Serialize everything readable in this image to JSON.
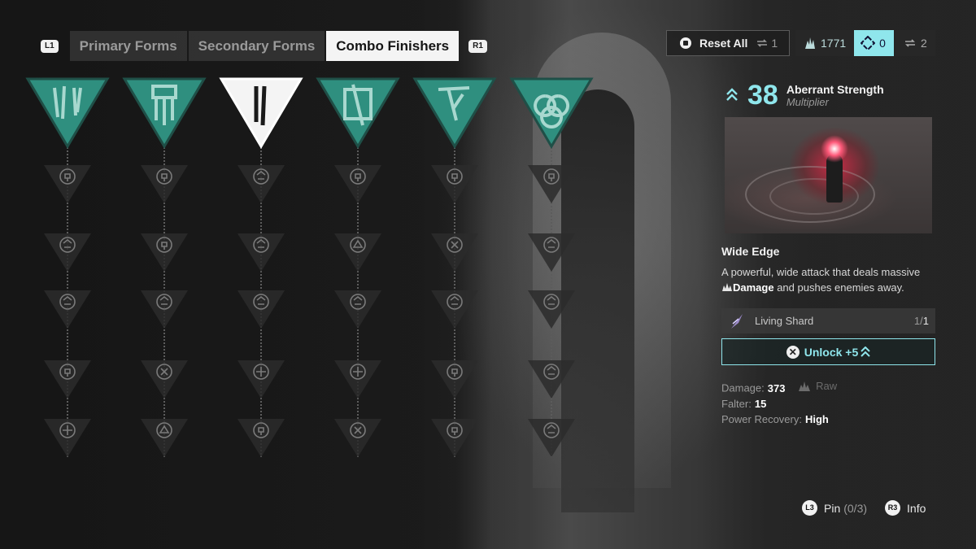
{
  "tabs": {
    "left_hint": "L1",
    "right_hint": "R1",
    "items": [
      {
        "label": "Primary Forms",
        "active": false
      },
      {
        "label": "Secondary Forms",
        "active": false
      },
      {
        "label": "Combo Finishers",
        "active": true
      }
    ]
  },
  "topbar": {
    "reset_label": "Reset All",
    "reset_cost": "1",
    "resource_a": "1771",
    "resource_b": "0",
    "resource_c": "2"
  },
  "colors": {
    "accent": "#8fe6ec",
    "teal": "#2f8f7f",
    "node": "#2c2c2c"
  },
  "tree": {
    "columns": [
      {
        "head": "twin-blades-icon",
        "head_selected": false,
        "nodes": [
          "skull-burst-icon",
          "skull-down-icon",
          "chevron-up-icon",
          "pin-up-icon",
          "cross-circle-icon"
        ]
      },
      {
        "head": "banner-icon",
        "head_selected": false,
        "nodes": [
          "circle-down-icon",
          "target-face-icon",
          "skull-rays-icon",
          "arrow-up-icon",
          "hand-icon"
        ]
      },
      {
        "head": "blade-icon",
        "head_selected": true,
        "nodes": [
          "stack-down-icon",
          "skull-plus-icon",
          "star-cross-icon",
          "clock-target-icon",
          "anchor-icon"
        ]
      },
      {
        "head": "square-slash-icon",
        "head_selected": false,
        "nodes": [
          "circle-wave-icon",
          "fist-icon",
          "skull-drip-icon",
          "flame-circle-icon",
          "infinity-icon"
        ]
      },
      {
        "head": "thorn-icon",
        "head_selected": false,
        "nodes": [
          "skull-cross-icon",
          "shield-target-icon",
          "burst-icon",
          "burst-flame-icon",
          "face-circle-icon"
        ]
      },
      {
        "head": "rings-icon",
        "head_selected": false,
        "nodes": [
          "skull-cycle-icon",
          "cycle-icon",
          "flame-down-icon",
          "cycle-open-icon",
          "swirl-icon"
        ]
      }
    ]
  },
  "panel": {
    "level": "38",
    "title": "Aberrant Strength",
    "subtitle": "Multiplier",
    "skill_name": "Wide Edge",
    "desc_pre": "A powerful, wide attack that deals massive",
    "desc_bold": "Damage",
    "desc_post": "and pushes enemies away.",
    "requirement": {
      "name": "Living Shard",
      "have": "1",
      "need": "1"
    },
    "unlock_label": "Unlock +5",
    "stats": {
      "damage_label": "Damage:",
      "damage_value": "373",
      "damage_type": "Raw",
      "falter_label": "Falter:",
      "falter_value": "15",
      "power_label": "Power Recovery:",
      "power_value": "High"
    }
  },
  "hints": {
    "pin_button": "L3",
    "pin_label": "Pin",
    "pin_count": "(0/3)",
    "info_button": "R3",
    "info_label": "Info"
  }
}
